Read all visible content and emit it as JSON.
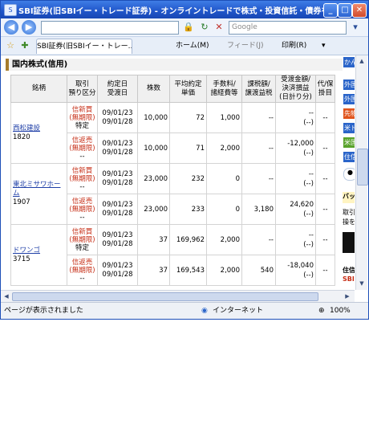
{
  "window": {
    "title": "SBI証券(旧SBIイー・トレード証券) - オンライントレードで株式・投資信託・債券を... - Wind...",
    "app_icon": "S",
    "buttons": {
      "minimize": "_",
      "maximize": "□",
      "close": "✕"
    }
  },
  "address_bar": {
    "back_icon": "◀",
    "forward_icon": "▶",
    "url": "",
    "lock_icon": "🔒",
    "refresh_icon": "↻",
    "stop_icon": "✕",
    "search_placeholder": "Google",
    "search_go": "▾"
  },
  "command_bar": {
    "favorites_star": "☆",
    "add_favorite": "✚",
    "tab_label": "SBI証券(旧SBIイー・トレー...",
    "home_label": "ホーム(M)",
    "feed_label": "フィード(J)",
    "print_label": "印刷(R)",
    "page_icon": "▾"
  },
  "section": {
    "title": "国内株式(信用)"
  },
  "table": {
    "headers": {
      "name": "銘柄",
      "trade_type": "取引\n預り区分",
      "dates": "約定日\n受渡日",
      "shares": "株数",
      "avg_price": "平均約定\n単価",
      "fee": "手数料/\n諸経費等",
      "tax": "課税額/\n譲渡益税",
      "receipt": "受渡金額/\n決済損益\n(日計り分)",
      "action": "代/保\n掛目"
    },
    "groups": [
      {
        "name": "西松建設",
        "code": "1820",
        "rows": [
          {
            "trade": "信新買",
            "limit": "(無期限)",
            "account": "特定",
            "date1": "09/01/23",
            "date2": "09/01/28",
            "shares": "10,000",
            "price": "72",
            "fee": "1,000",
            "tax": "--",
            "receipt": "--",
            "receipt2": "(--)",
            "action": "--"
          },
          {
            "trade": "信返売",
            "limit": "(無期限)",
            "account": "--",
            "date1": "09/01/23",
            "date2": "09/01/28",
            "shares": "10,000",
            "price": "71",
            "fee": "2,000",
            "tax": "--",
            "receipt": "-12,000",
            "receipt2": "(--)",
            "action": "--"
          }
        ]
      },
      {
        "name": "東北ミサワホーム",
        "code": "1907",
        "rows": [
          {
            "trade": "信新買",
            "limit": "(無期限)",
            "account": "--",
            "date1": "09/01/23",
            "date2": "09/01/28",
            "shares": "23,000",
            "price": "232",
            "fee": "0",
            "tax": "--",
            "receipt": "--",
            "receipt2": "(--)",
            "action": "--"
          },
          {
            "trade": "信返売",
            "limit": "(無期限)",
            "account": "--",
            "date1": "09/01/23",
            "date2": "09/01/28",
            "shares": "23,000",
            "price": "233",
            "fee": "0",
            "tax": "3,180",
            "receipt": "24,620",
            "receipt2": "(--)",
            "action": "--"
          }
        ]
      },
      {
        "name": "ドワンゴ",
        "code": "3715",
        "rows": [
          {
            "trade": "信新買",
            "limit": "(無期限)",
            "account": "特定",
            "date1": "09/01/23",
            "date2": "09/01/28",
            "shares": "37",
            "price": "169,962",
            "fee": "2,000",
            "tax": "--",
            "receipt": "--",
            "receipt2": "(--)",
            "action": "--"
          },
          {
            "trade": "信返売",
            "limit": "(無期限)",
            "account": "--",
            "date1": "09/01/23",
            "date2": "09/01/28",
            "shares": "37",
            "price": "169,543",
            "fee": "2,000",
            "tax": "540",
            "receipt": "-18,040",
            "receipt2": "(--)",
            "action": "--"
          }
        ]
      }
    ]
  },
  "side_panel": {
    "items": [
      {
        "label": "かん",
        "color": "#2a64c9"
      },
      {
        "label": "外国",
        "color": "#2a64c9"
      },
      {
        "label": "外国",
        "color": "#2a64c9"
      },
      {
        "label": "先物",
        "color": "#e0541c"
      },
      {
        "label": "米ド",
        "color": "#2a64c9"
      },
      {
        "label": "米国",
        "color": "#58a22a"
      },
      {
        "label": "住信",
        "color": "#2a64c9"
      }
    ],
    "texts": [
      "バッ",
      "取引",
      "操を",
      "住信",
      "SBI"
    ]
  },
  "status_bar": {
    "message": "ページが表示されました",
    "zone": "インターネット",
    "zoom": "100%"
  }
}
